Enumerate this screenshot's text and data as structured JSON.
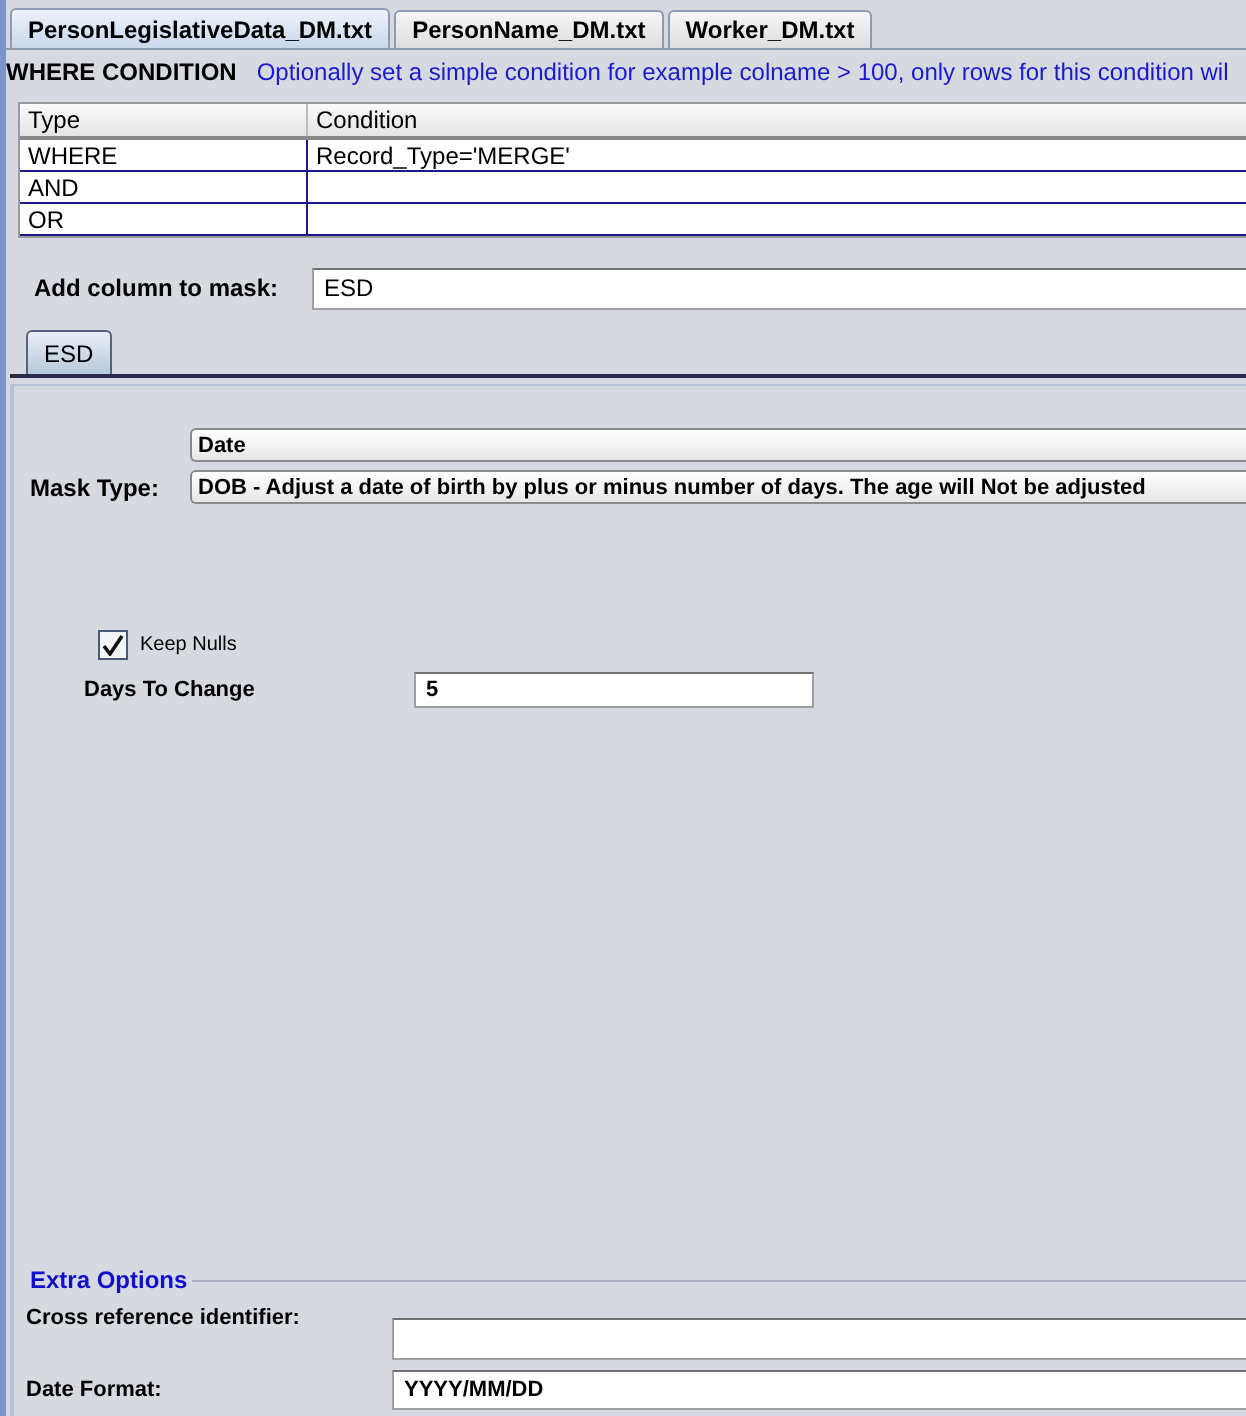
{
  "file_tabs": [
    {
      "label": "PersonLegislativeData_DM.txt",
      "selected": true
    },
    {
      "label": "PersonName_DM.txt",
      "selected": false
    },
    {
      "label": "Worker_DM.txt",
      "selected": false
    }
  ],
  "where_condition": {
    "title": "WHERE CONDITION",
    "hint": "Optionally set a simple condition for example colname > 100, only rows for this condition wil",
    "columns": [
      "Type",
      "Condition"
    ],
    "rows": [
      {
        "type": "WHERE",
        "condition": "Record_Type='MERGE'"
      },
      {
        "type": "AND"
      },
      {
        "type": "OR"
      }
    ]
  },
  "add_column": {
    "label": "Add column to mask:",
    "value": "ESD"
  },
  "column_tabs": [
    {
      "label": "ESD",
      "selected": true
    }
  ],
  "mask": {
    "category": "Date",
    "label": "Mask Type:",
    "type": "DOB - Adjust a date of birth by plus or minus number of days. The age will Not be adjusted"
  },
  "keep_nulls": {
    "label": "Keep Nulls",
    "checked": true
  },
  "days_to_change": {
    "label": "Days To Change",
    "value": "5"
  },
  "extra_options": {
    "title": "Extra Options",
    "fields": [
      {
        "label": "Cross reference identifier:"
      },
      {
        "label": "Date Format:",
        "value": "YYYY/MM/DD"
      }
    ]
  }
}
